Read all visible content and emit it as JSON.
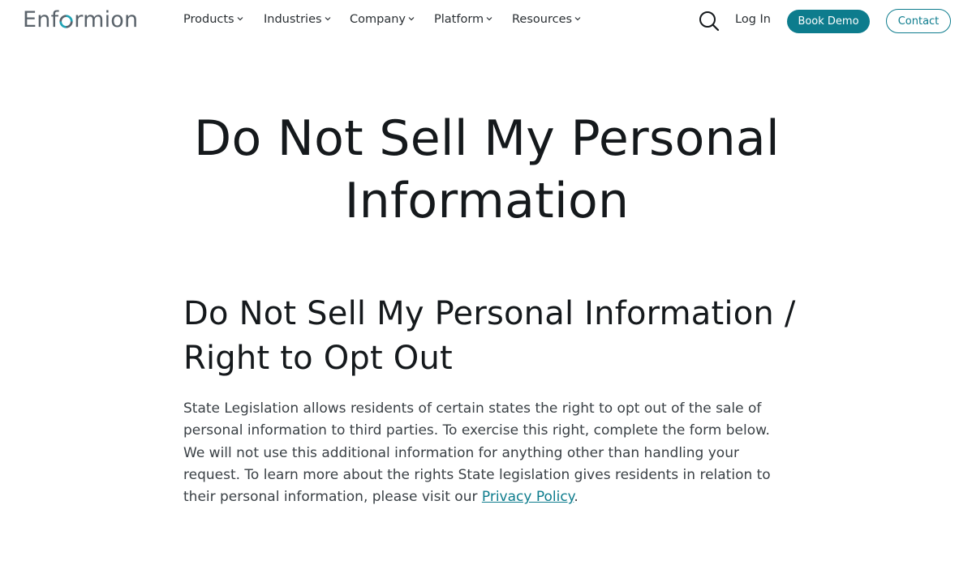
{
  "header": {
    "logo": {
      "prefix": "Enf",
      "suffix": "rmion"
    },
    "nav": [
      {
        "label": "Products"
      },
      {
        "label": "Industries"
      },
      {
        "label": "Company"
      },
      {
        "label": "Platform"
      },
      {
        "label": "Resources"
      }
    ],
    "login_label": "Log In",
    "book_demo_label": "Book Demo",
    "contact_label": "Contact"
  },
  "main": {
    "page_title": "Do Not Sell My Personal Information",
    "section_title": "Do Not Sell My Personal Information / Right to Opt Out",
    "body": {
      "text": "State Legislation allows residents of certain states the right to opt out of the sale of personal information to third parties. To exercise this right, complete the form below. We will not use this additional information for anything other than handling your request. To learn more about the rights State legislation gives residents in relation to their personal information, please visit our ",
      "link_label": "Privacy Policy",
      "after_link": "."
    }
  },
  "colors": {
    "accent": "#0d7c8d",
    "text": "#15191c",
    "logo_gray": "#59626a"
  },
  "icons": {
    "search": "search-icon",
    "chevron": "chevron-down-icon",
    "logo_mark": "logo-ring-icon"
  }
}
